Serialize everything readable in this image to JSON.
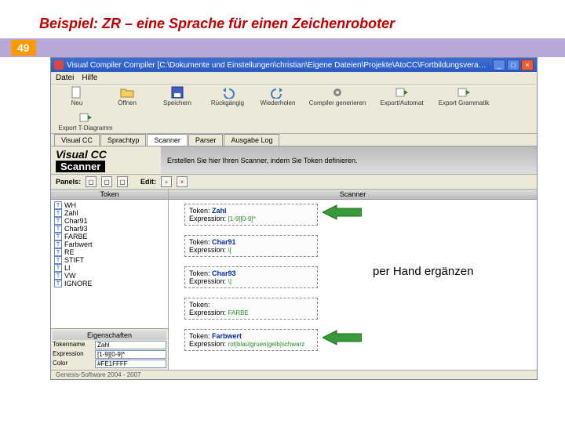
{
  "slide": {
    "title": "Beispiel:  ZR – eine Sprache für einen Zeichenroboter",
    "page_number": "49",
    "annotation": "per Hand ergänzen"
  },
  "window": {
    "title": "Visual Compiler Compiler [C:\\Dokumente und Einstellungen\\christian\\Eigene Dateien\\Projekte\\AtoCC\\Fortbildungsvera…",
    "menu": {
      "file": "Datei",
      "help": "Hilfe"
    },
    "toolbar": {
      "new": "Neu",
      "open": "Öffnen",
      "save": "Speichern",
      "undo": "Rückgängig",
      "redo": "Wiederholen",
      "compile": "Compiler generieren",
      "export_automat": "Export/Automat",
      "export_grammar": "Export Grammatik",
      "export_tdiagram": "Export T-Diagramm"
    },
    "tabs": {
      "visualcc": "Visual CC",
      "sprachtyp": "Sprachtyp",
      "scanner": "Scanner",
      "parser": "Parser",
      "log": "Ausgabe Log"
    },
    "banner": {
      "logo_line1": "Visual CC",
      "logo_line2": "Scanner",
      "hint": "Erstellen Sie hier Ihren Scanner, indem Sie Token definieren."
    },
    "panels_label": "Panels:",
    "edit_label": "Edit:",
    "columns": {
      "token": "Token",
      "scanner": "Scanner"
    },
    "tokens": [
      "WH",
      "Zahl",
      "Char91",
      "Char93",
      "FARBE",
      "Farbwert",
      "RE",
      "STIFT",
      "LI",
      "VW",
      "IGNORE"
    ],
    "properties": {
      "header": "Eigenschaften",
      "tokenname_label": "Tokenname",
      "tokenname_value": "Zahl",
      "expression_label": "Expression",
      "expression_value": "[1-9][0-9]*",
      "color_label": "Color",
      "color_value": "#FE1FFFF"
    },
    "cards": [
      {
        "label_token": "Token:",
        "name": "Zahl",
        "label_expr": "Expression:",
        "expr": "[1-9][0-9]*"
      },
      {
        "label_token": "Token:",
        "name": "Char91",
        "label_expr": "Expression:",
        "expr": "\\["
      },
      {
        "label_token": "Token:",
        "name": "Char93",
        "label_expr": "Expression:",
        "expr": "\\]"
      },
      {
        "label_token": "Token:",
        "name": "",
        "label_expr": "Expression:",
        "expr": "FARBE"
      },
      {
        "label_token": "Token:",
        "name": "Farbwert",
        "label_expr": "Expression:",
        "expr": "rot|blau|gruen|gelb|schwarz"
      }
    ],
    "status": "Genesis-Software 2004 - 2007"
  }
}
